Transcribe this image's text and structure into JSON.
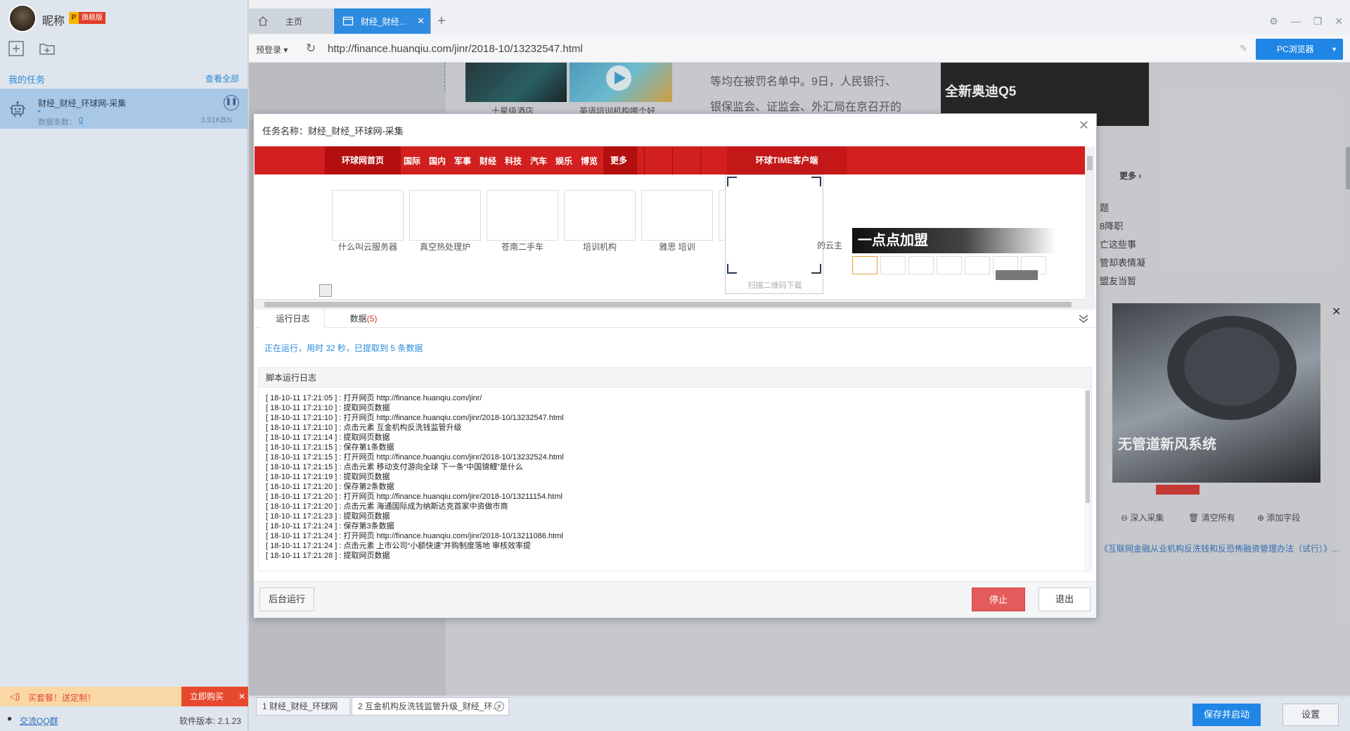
{
  "sidebar": {
    "nickname": "昵称",
    "vip_letter": "P",
    "vip_label": "旗舰版",
    "my_tasks": "我的任务",
    "view_all": "查看全部",
    "task": {
      "name": "财经_财经_环球网-采集",
      "count_label": "数据条数：",
      "count": "0",
      "speed": "3.91KB/s"
    },
    "promo_text": "买套餐！送定制！",
    "promo_buy": "立即购买",
    "qq_group": "交流QQ群",
    "version": "软件版本: 2.1.23"
  },
  "browser": {
    "tabs": [
      {
        "label": "主页"
      },
      {
        "label": "财经_财经..."
      }
    ],
    "login": "预登录",
    "url": "http://finance.huanqiu.com/jinr/2018-10/13232547.html",
    "pc_browser": "PC浏览器"
  },
  "webpage": {
    "caption1": "十星级酒店",
    "caption2": "英语培训机构哪个好",
    "text_lines": [
      "等均在被罚名单中。9日，人民银行、",
      "银保监会、证监会、外汇局在京召开的"
    ],
    "ad_top_title": "全新奥迪Q5",
    "more": "更多",
    "side_items": [
      "题",
      "8降职",
      "亡这些事",
      "管却表情凝",
      "盟友当暂"
    ],
    "ad_big_title": "无管道新风系统",
    "actions": [
      "深入采集",
      "清空所有",
      "添加字段"
    ],
    "article_link": "《互联网金融从业机构反洗钱和反恐怖融资管理办法（试行）》..."
  },
  "dialog": {
    "title": "任务名称：财经_财经_环球网-采集",
    "preview": {
      "nav_home": "环球网首页",
      "nav_items": [
        "国际",
        "国内",
        "军事",
        "财经",
        "科技",
        "汽车",
        "娱乐",
        "博览"
      ],
      "nav_more": "更多",
      "nav_client": "环球TIME客户端",
      "cards": [
        "什么叫云服务器",
        "真空热处理炉",
        "苍南二手车",
        "培训机构",
        "雅思 培训"
      ],
      "qr_label": "扫描二维码下载",
      "cloud": "的云主",
      "join": "一点点加盟"
    },
    "tabs": {
      "log": "运行日志",
      "data": "数据",
      "data_count": "(5)"
    },
    "status": "正在运行，用时 32 秒，已提取到 5 条数据",
    "log_title": "脚本运行日志",
    "log_lines": [
      "[ 18-10-11 17:21:05 ] : 打开网页 http://finance.huanqiu.com/jinr/",
      "[ 18-10-11 17:21:10 ] : 提取网页数据",
      "[ 18-10-11 17:21:10 ] : 打开网页 http://finance.huanqiu.com/jinr/2018-10/13232547.html",
      "[ 18-10-11 17:21:10 ] : 点击元素 互金机构反洗钱监管升级",
      "[ 18-10-11 17:21:14 ] : 提取网页数据",
      "[ 18-10-11 17:21:15 ] : 保存第1条数据",
      "[ 18-10-11 17:21:15 ] : 打开网页 http://finance.huanqiu.com/jinr/2018-10/13232524.html",
      "[ 18-10-11 17:21:15 ] : 点击元素 移动支付游向全球 下一条“中国锦鲤”是什么",
      "[ 18-10-11 17:21:19 ] : 提取网页数据",
      "[ 18-10-11 17:21:20 ] : 保存第2条数据",
      "[ 18-10-11 17:21:20 ] : 打开网页 http://finance.huanqiu.com/jinr/2018-10/13211154.html",
      "[ 18-10-11 17:21:20 ] : 点击元素 海通国际成为纳斯达克首家中资做市商",
      "[ 18-10-11 17:21:23 ] : 提取网页数据",
      "[ 18-10-11 17:21:24 ] : 保存第3条数据",
      "[ 18-10-11 17:21:24 ] : 打开网页 http://finance.huanqiu.com/jinr/2018-10/13211086.html",
      "[ 18-10-11 17:21:24 ] : 点击元素 上市公司“小额快速”并购制度落地 审核效率提",
      "[ 18-10-11 17:21:28 ] : 提取网页数据"
    ],
    "bg_run": "后台运行",
    "stop": "停止",
    "exit": "退出"
  },
  "bottom": {
    "tab1": "1 财经_财经_环球网",
    "tab2": "2 互金机构反洗钱监管升级_财经_环...",
    "save_start": "保存并启动",
    "settings": "设置"
  },
  "colors": {
    "accent": "#1f86e6",
    "stop": "#e45b5b",
    "nav_red": "#d21f1f"
  }
}
